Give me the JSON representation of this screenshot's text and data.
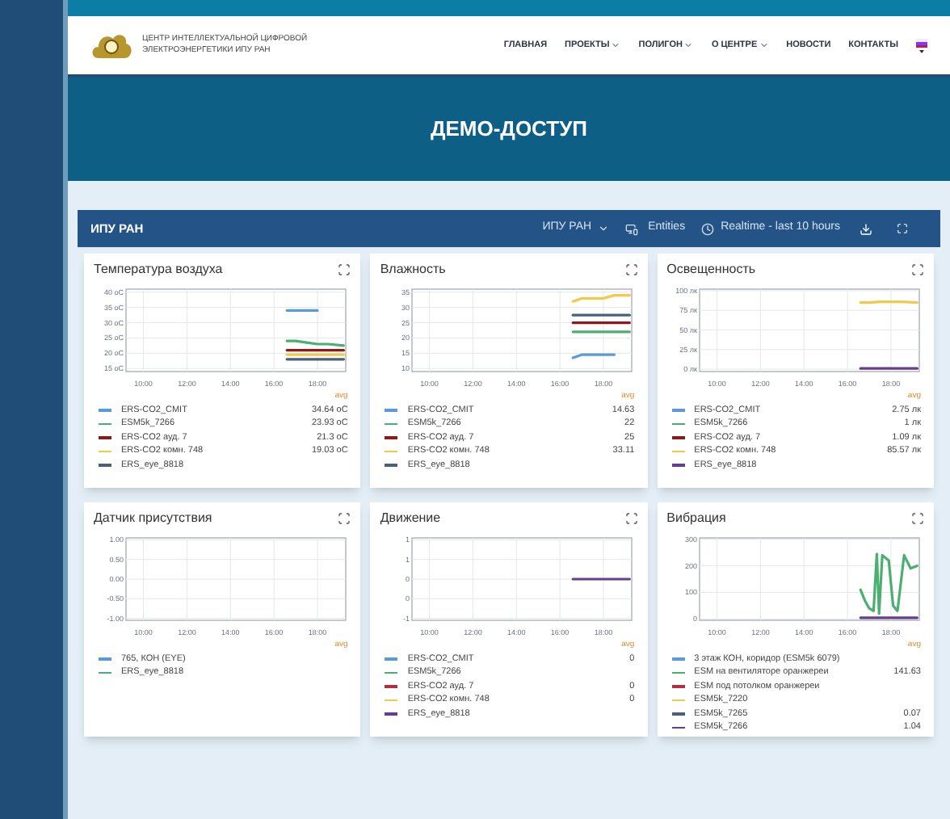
{
  "header": {
    "logo_lines": [
      "ЦЕНТР ИНТЕЛЛЕКТУАЛЬНОЙ ЦИФРОВОЙ",
      "ЭЛЕКТРОЭНЕРГЕТИКИ ИПУ РАН"
    ],
    "nav": [
      {
        "label": "ГЛАВНАЯ",
        "dropdown": false
      },
      {
        "label": "ПРОЕКТЫ",
        "dropdown": true
      },
      {
        "label": "ПОЛИГОН",
        "dropdown": true
      },
      {
        "label": "О ЦЕНТРЕ",
        "dropdown": true
      },
      {
        "label": "НОВОСТИ",
        "dropdown": false
      },
      {
        "label": "КОНТАКТЫ",
        "dropdown": false
      }
    ]
  },
  "banner": {
    "title": "ДЕМО-ДОСТУП"
  },
  "dashboard": {
    "title": "ИПУ РАН",
    "entity_select": "ИПУ РАН",
    "entities": "Entities",
    "timewindow": "Realtime - last 10 hours",
    "panels": [
      {
        "title": "Температура воздуха",
        "avg_label": "avg",
        "legend": [
          {
            "name": "ERS-CO2_CMIT",
            "color": "#5b9bd5",
            "value": "34.64 oC"
          },
          {
            "name": "ESM5k_7266",
            "color": "#4caf72",
            "value": "23.93 oC"
          },
          {
            "name": "ERS-CO2 ауд. 7",
            "color": "#8b1a1a",
            "value": "21.3 oC"
          },
          {
            "name": "ERS-CO2 комн. 748",
            "color": "#f2c94c",
            "value": "19.03 oC"
          },
          {
            "name": "ERS_eye_8818",
            "color": "#4a5f7a"
          }
        ],
        "chart_data": {
          "type": "line",
          "grid": true,
          "x": [
            16.6,
            17,
            17.5,
            18,
            18.5,
            19.2
          ],
          "xlim": [
            9.2,
            19.3
          ],
          "ylim": [
            14,
            41
          ],
          "xticks": [
            {
              "value": 10,
              "label": "10:00"
            },
            {
              "value": 12,
              "label": "12:00"
            },
            {
              "value": 14,
              "label": "14:00"
            },
            {
              "value": 16,
              "label": "16:00"
            },
            {
              "value": 18,
              "label": "18:00"
            }
          ],
          "yticks": [
            {
              "value": 15,
              "label": "15 oC"
            },
            {
              "value": 20,
              "label": "20 oC"
            },
            {
              "value": 25,
              "label": "25 oC"
            },
            {
              "value": 30,
              "label": "30 oC"
            },
            {
              "value": 35,
              "label": "35 oC"
            },
            {
              "value": 40,
              "label": "40 oC"
            }
          ],
          "series": [
            {
              "color": "#5b9bd5",
              "values": [
                34,
                34,
                34,
                34,
                null,
                null
              ]
            },
            {
              "color": "#4caf72",
              "values": [
                24,
                24,
                23.5,
                23,
                23,
                22.5
              ]
            },
            {
              "color": "#8b1a1a",
              "values": [
                21,
                21,
                21,
                21,
                21,
                21
              ]
            },
            {
              "color": "#f2c94c",
              "values": [
                19.5,
                19.5,
                19.5,
                19.5,
                19.5,
                19.5
              ]
            },
            {
              "color": "#4a5f7a",
              "values": [
                18,
                18,
                18,
                18,
                18,
                18
              ]
            }
          ]
        }
      },
      {
        "title": "Влажность",
        "avg_label": "avg",
        "legend": [
          {
            "name": "ERS-CO2_CMIT",
            "color": "#5b9bd5",
            "value": "14.63"
          },
          {
            "name": "ESM5k_7266",
            "color": "#4caf72",
            "value": "22"
          },
          {
            "name": "ERS-CO2 ауд. 7",
            "color": "#8b1a1a",
            "value": "25"
          },
          {
            "name": "ERS-CO2 комн. 748",
            "color": "#f2c94c",
            "value": "33.11"
          },
          {
            "name": "ERS_eye_8818",
            "color": "#4a5f7a"
          }
        ],
        "chart_data": {
          "type": "line",
          "grid": true,
          "x": [
            16.6,
            17,
            17.5,
            18,
            18.5,
            19.2
          ],
          "xlim": [
            9.2,
            19.3
          ],
          "ylim": [
            9,
            36
          ],
          "xticks": [
            {
              "value": 10,
              "label": "10:00"
            },
            {
              "value": 12,
              "label": "12:00"
            },
            {
              "value": 14,
              "label": "14:00"
            },
            {
              "value": 16,
              "label": "16:00"
            },
            {
              "value": 18,
              "label": "18:00"
            }
          ],
          "yticks": [
            10,
            15,
            20,
            25,
            30,
            35
          ],
          "series": [
            {
              "color": "#5b9bd5",
              "values": [
                13.5,
                14.5,
                14.5,
                14.5,
                14.5,
                null
              ]
            },
            {
              "color": "#4caf72",
              "values": [
                22,
                22,
                22,
                22,
                22,
                22
              ]
            },
            {
              "color": "#8b1a1a",
              "values": [
                25,
                25,
                25,
                25,
                25,
                25
              ]
            },
            {
              "color": "#f2c94c",
              "values": [
                32,
                33,
                33,
                33,
                34,
                34
              ]
            },
            {
              "color": "#4a5f7a",
              "values": [
                27.5,
                27.5,
                27.5,
                27.5,
                27.5,
                27.5
              ]
            }
          ]
        }
      },
      {
        "title": "Освещенность",
        "avg_label": "avg",
        "legend": [
          {
            "name": "ERS-CO2_CMIT",
            "color": "#5b9bd5",
            "value": "2.75 лк"
          },
          {
            "name": "ESM5k_7266",
            "color": "#4caf72",
            "value": "1 лк"
          },
          {
            "name": "ERS-CO2 ауд. 7",
            "color": "#8b1a1a",
            "value": "1.09 лк"
          },
          {
            "name": "ERS-CO2 комн. 748",
            "color": "#f2c94c",
            "value": "85.57 лк"
          },
          {
            "name": "ERS_eye_8818",
            "color": "#6a3d8a"
          }
        ],
        "chart_data": {
          "type": "line",
          "grid": true,
          "x": [
            16.6,
            17,
            17.5,
            18,
            18.5,
            19.2
          ],
          "xlim": [
            9.2,
            19.3
          ],
          "ylim": [
            -3,
            102
          ],
          "xticks": [
            {
              "value": 10,
              "label": "10:00"
            },
            {
              "value": 12,
              "label": "12:00"
            },
            {
              "value": 14,
              "label": "14:00"
            },
            {
              "value": 16,
              "label": "16:00"
            },
            {
              "value": 18,
              "label": "18:00"
            }
          ],
          "yticks": [
            {
              "value": 0,
              "label": "0 лк"
            },
            {
              "value": 25,
              "label": "25 лк"
            },
            {
              "value": 50,
              "label": "50 лк"
            },
            {
              "value": 75,
              "label": "75 лк"
            },
            {
              "value": 100,
              "label": "100 лк"
            }
          ],
          "series": [
            {
              "color": "#f2c94c",
              "values": [
                85,
                85,
                86,
                86,
                86,
                85
              ]
            },
            {
              "color": "#6a3d8a",
              "values": [
                1,
                1,
                1,
                1,
                1,
                1
              ]
            }
          ]
        }
      },
      {
        "title": "Датчик присутствия",
        "avg_label": "avg",
        "legend": [
          {
            "name": "765, КОН (EYE)",
            "color": "#5b9bd5"
          },
          {
            "name": "ERS_eye_8818",
            "color": "#4caf72"
          }
        ],
        "chart_data": {
          "type": "line",
          "grid": true,
          "xlim": [
            9.2,
            19.3
          ],
          "ylim": [
            -1.05,
            1.05
          ],
          "xticks": [
            {
              "value": 10,
              "label": "10:00"
            },
            {
              "value": 12,
              "label": "12:00"
            },
            {
              "value": 14,
              "label": "14:00"
            },
            {
              "value": 16,
              "label": "16:00"
            },
            {
              "value": 18,
              "label": "18:00"
            }
          ],
          "yticks": [
            {
              "value": 1,
              "label": "1.00"
            },
            {
              "value": 0.5,
              "label": "0.50"
            },
            {
              "value": 0,
              "label": "0.00"
            },
            {
              "value": -0.5,
              "label": "-0.50"
            },
            {
              "value": -1,
              "label": "-1.00"
            }
          ]
        }
      },
      {
        "title": "Движение",
        "avg_label": "avg",
        "legend": [
          {
            "name": "ERS-CO2_CMIT",
            "color": "#5b9bd5",
            "value": "0"
          },
          {
            "name": "ESM5k_7266",
            "color": "#4caf72"
          },
          {
            "name": "ERS-CO2 ауд. 7",
            "color": "#b03040",
            "value": "0"
          },
          {
            "name": "ERS-CO2 комн. 748",
            "color": "#f2c94c",
            "value": "0"
          },
          {
            "name": "ERS_eye_8818",
            "color": "#6a3d8a"
          }
        ],
        "chart_data": {
          "type": "line",
          "grid": true,
          "x": [
            16.6,
            19.2
          ],
          "xlim": [
            9.2,
            19.3
          ],
          "ylim": [
            -1.05,
            1.05
          ],
          "xticks": [
            {
              "value": 10,
              "label": "10:00"
            },
            {
              "value": 12,
              "label": "12:00"
            },
            {
              "value": 14,
              "label": "14:00"
            },
            {
              "value": 16,
              "label": "16:00"
            },
            {
              "value": 18,
              "label": "18:00"
            }
          ],
          "yticks": [
            {
              "value": 1,
              "label": "1"
            },
            {
              "value": 0.5,
              "label": "1"
            },
            {
              "value": 0,
              "label": "0"
            },
            {
              "value": -0.5,
              "label": "0"
            },
            {
              "value": -1,
              "label": "-1"
            }
          ],
          "series": [
            {
              "color": "#6a3d8a",
              "values": [
                0,
                0
              ]
            }
          ]
        }
      },
      {
        "title": "Вибрация",
        "avg_label": "avg",
        "legend": [
          {
            "name": "3 этаж КОН, коридор (ESM5k 6079)",
            "color": "#5b9bd5"
          },
          {
            "name": "ESM на вентиляторе оранжереи",
            "color": "#4caf72",
            "value": "141.63"
          },
          {
            "name": "ESM под потолком оранжереи",
            "color": "#b03040"
          },
          {
            "name": "ESM5k_7220",
            "color": "#f2c94c"
          },
          {
            "name": "ESM5k_7265",
            "color": "#4a5f7a",
            "value": "0.07"
          },
          {
            "name": "ESM5k_7266",
            "color": "#6a3d8a",
            "value": "1.04"
          }
        ],
        "chart_data": {
          "type": "line",
          "grid": true,
          "x": [
            16.6,
            16.8,
            17,
            17.2,
            17.35,
            17.45,
            17.6,
            17.9,
            18.1,
            18.3,
            18.6,
            18.9,
            19.2
          ],
          "xlim": [
            9.2,
            19.3
          ],
          "ylim": [
            -5,
            305
          ],
          "xticks": [
            {
              "value": 10,
              "label": "10:00"
            },
            {
              "value": 12,
              "label": "12:00"
            },
            {
              "value": 14,
              "label": "14:00"
            },
            {
              "value": 16,
              "label": "16:00"
            },
            {
              "value": 18,
              "label": "18:00"
            }
          ],
          "yticks": [
            0,
            100,
            200,
            300
          ],
          "series": [
            {
              "color": "#4caf72",
              "values": [
                110,
                70,
                40,
                30,
                245,
                20,
                240,
                220,
                50,
                30,
                240,
                190,
                200
              ]
            },
            {
              "color": "#6a3d8a",
              "values": [
                5,
                5,
                5,
                5,
                5,
                5,
                5,
                5,
                5,
                5,
                5,
                5,
                5
              ]
            }
          ]
        }
      }
    ]
  }
}
